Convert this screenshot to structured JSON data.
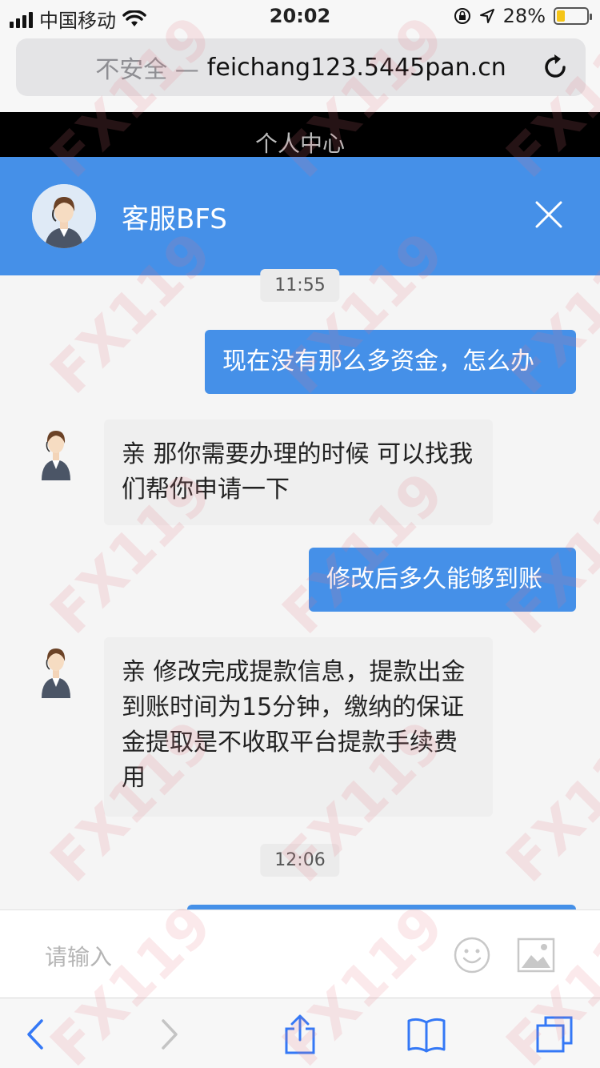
{
  "status_bar": {
    "carrier": "中国移动",
    "time": "20:02",
    "battery_percent": "28%",
    "battery_level": 0.28
  },
  "browser": {
    "insecure_label": "不安全 —",
    "domain": "feichang123.5445pan.cn"
  },
  "page": {
    "header_title": "个人中心"
  },
  "chat": {
    "agent_name": "客服BFS",
    "messages": [
      {
        "type": "time",
        "text": "11:55"
      },
      {
        "type": "sent",
        "text": "现在没有那么多资金，怎么办"
      },
      {
        "type": "received",
        "text": "亲 那你需要办理的时候 可以找我们帮你申请一下"
      },
      {
        "type": "sent",
        "text": "修改后多久能够到账"
      },
      {
        "type": "received",
        "text": "亲 修改完成提款信息，提款出金到账时间为15分钟，缴纳的保证金提取是不收取平台提款手续费用"
      },
      {
        "type": "time",
        "text": "12:06"
      }
    ],
    "input_placeholder": "请输入"
  },
  "icons": {
    "reload": "reload-icon",
    "close": "close-icon",
    "emoji": "emoji-icon",
    "image": "image-icon",
    "back": "back-icon",
    "forward": "forward-icon",
    "share": "share-icon",
    "bookmarks": "bookmarks-icon",
    "tabs": "tabs-icon"
  },
  "watermark": "FX119",
  "colors": {
    "accent": "#4590e8",
    "ios_blue": "#3478f6"
  }
}
